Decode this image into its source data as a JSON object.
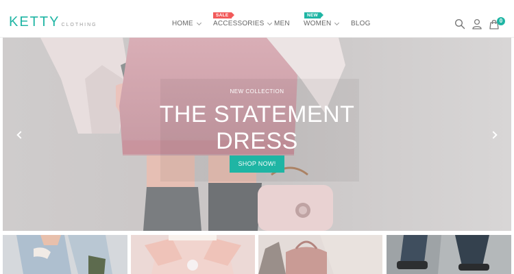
{
  "brand": {
    "name": "KETTY",
    "tagline": "CLOTHING"
  },
  "colors": {
    "accent": "#1fb5a4",
    "sale_badge": "#f25a5a"
  },
  "nav": {
    "items": [
      {
        "label": "HOME",
        "has_dropdown": true
      },
      {
        "label": "ACCESSORIES",
        "has_dropdown": true,
        "badge": "SALE"
      },
      {
        "label": "MEN",
        "has_dropdown": false
      },
      {
        "label": "WOMEN",
        "has_dropdown": true,
        "badge": "NEW"
      },
      {
        "label": "BLOG",
        "has_dropdown": false
      }
    ]
  },
  "header_icons": {
    "search": "search-icon",
    "account": "user-icon",
    "cart": "shopping-bag-icon",
    "cart_count": "0"
  },
  "hero": {
    "label": "NEW COLLECTION",
    "title_line1": "THE STATEMENT",
    "title_line2": "DRESS",
    "button": "SHOP NOW!",
    "prev_icon": "chevron-left-icon",
    "next_icon": "chevron-right-icon"
  },
  "thumbnails": [
    {
      "name": "ripped-jeans-image"
    },
    {
      "name": "bubblegum-woman-image"
    },
    {
      "name": "pink-backpack-image"
    },
    {
      "name": "denim-sneakers-image"
    }
  ]
}
